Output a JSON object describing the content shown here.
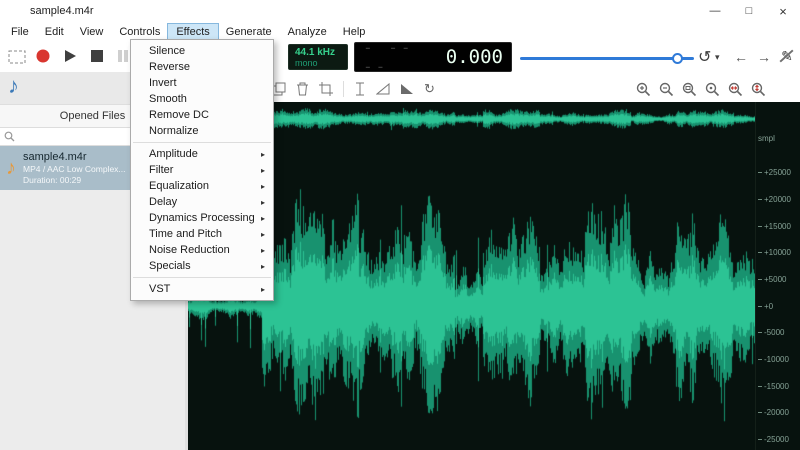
{
  "window": {
    "title": "sample4.m4r",
    "controls": {
      "minimize": "—",
      "maximize": "□",
      "close": "×"
    }
  },
  "menubar": {
    "items": [
      "File",
      "Edit",
      "View",
      "Controls",
      "Effects",
      "Generate",
      "Analyze",
      "Help"
    ],
    "active": "Effects"
  },
  "effects_menu": {
    "items": [
      {
        "label": "Silence"
      },
      {
        "label": "Reverse"
      },
      {
        "label": "Invert"
      },
      {
        "label": "Smooth"
      },
      {
        "label": "Remove DC"
      },
      {
        "label": "Normalize"
      },
      {
        "separator": true
      },
      {
        "label": "Amplitude",
        "submenu": true
      },
      {
        "label": "Filter",
        "submenu": true
      },
      {
        "label": "Equalization",
        "submenu": true
      },
      {
        "label": "Delay",
        "submenu": true
      },
      {
        "label": "Dynamics Processing",
        "submenu": true
      },
      {
        "label": "Time and Pitch",
        "submenu": true
      },
      {
        "label": "Noise Reduction",
        "submenu": true
      },
      {
        "label": "Specials",
        "submenu": true
      },
      {
        "separator": true
      },
      {
        "label": "VST",
        "submenu": true
      }
    ]
  },
  "toolbar": {
    "sample_rate": "44.1 kHz",
    "channel_mode": "mono",
    "time_ghost": "- -- --",
    "time_value": "0.000"
  },
  "sidebar": {
    "panel_title": "Opened Files",
    "file": {
      "name": "sample4.m4r",
      "format": "MP4 / AAC Low Complex...",
      "duration": "Duration: 00:29"
    }
  },
  "waveform": {
    "unit_label": "smpl",
    "scale_labels": [
      "+25000",
      "+20000",
      "+15000",
      "+10000",
      "+5000",
      "+0",
      "-5000",
      "-10000",
      "-15000",
      "-20000",
      "-25000"
    ],
    "wave_color": "#18926f",
    "wave_core_color": "#2cc394",
    "bg_color": "#07120e"
  },
  "icons": {
    "music_note": "♪",
    "history": "↺",
    "dropdown": "▾",
    "back": "←",
    "forward": "→",
    "pencil": "✎",
    "loop": "↻",
    "submenu_arrow": "▸"
  }
}
